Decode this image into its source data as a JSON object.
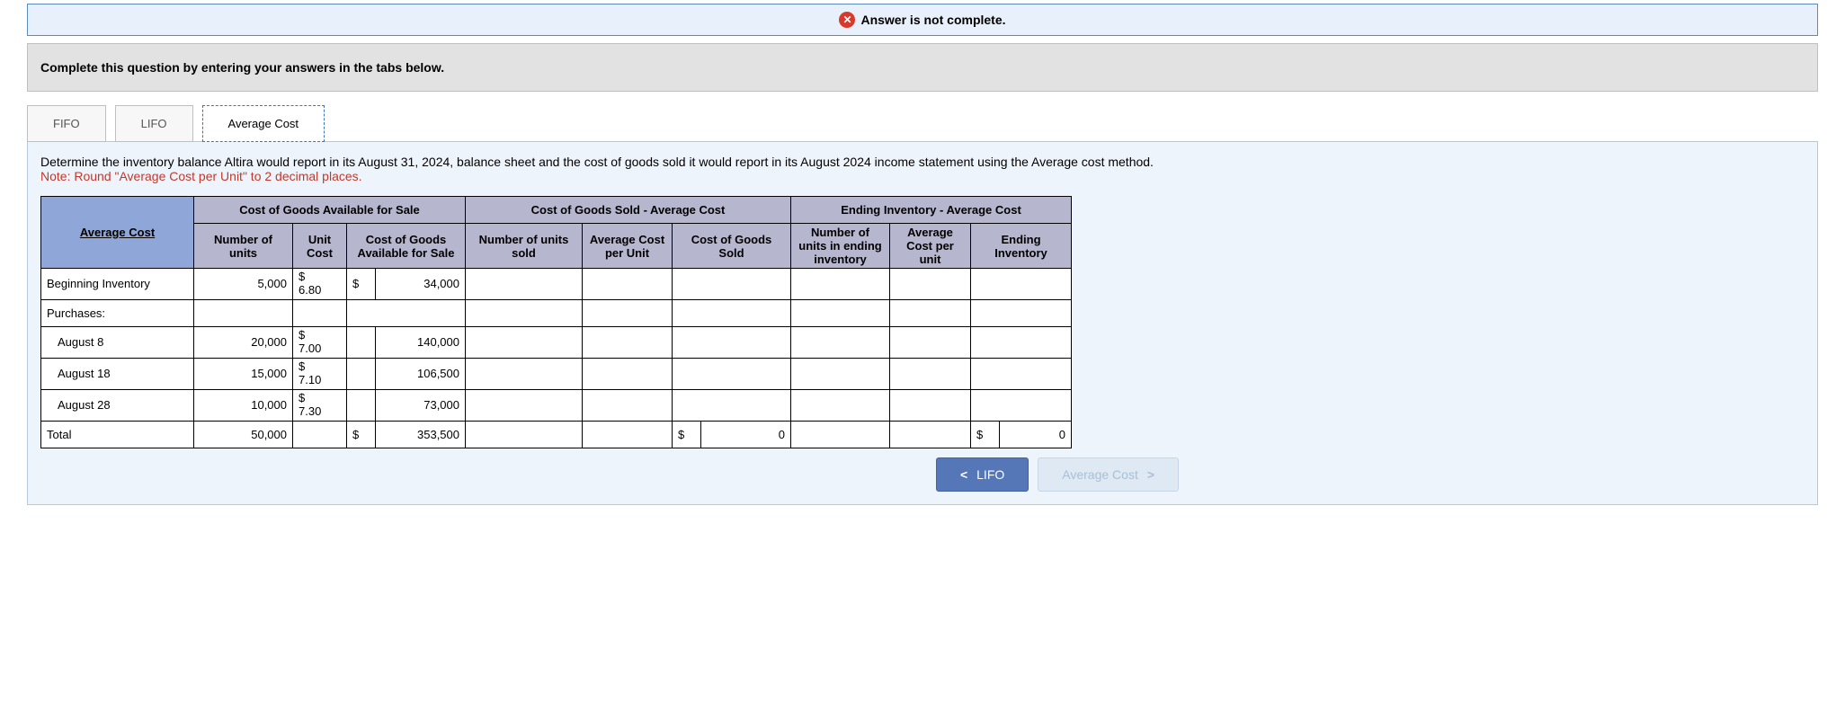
{
  "status": {
    "icon": "x-icon",
    "text": "Answer is not complete."
  },
  "instruction": "Complete this question by entering your answers in the tabs below.",
  "tabs": [
    {
      "label": "FIFO",
      "active": false
    },
    {
      "label": "LIFO",
      "active": false
    },
    {
      "label": "Average Cost",
      "active": true
    }
  ],
  "question": {
    "text": "Determine the inventory balance Altira would report in its August 31, 2024, balance sheet and the cost of goods sold it would report in its August 2024 income statement using the Average cost method.",
    "note": "Note: Round \"Average Cost per Unit\" to 2 decimal places."
  },
  "table": {
    "rowhead": "Average Cost",
    "group1": "Cost of Goods Available for Sale",
    "group2": "Cost of Goods Sold - Average Cost",
    "group3": "Ending Inventory - Average Cost",
    "sub": {
      "units": "Number of units",
      "unitcost": "Unit Cost",
      "cogas": "Cost of Goods Available for Sale",
      "unitsold": "Number of units sold",
      "avgcpu": "Average Cost per Unit",
      "cogs": "Cost of Goods Sold",
      "unitsend": "Number of units in ending inventory",
      "avgcpu2": "Average Cost per unit",
      "endinv": "Ending Inventory"
    },
    "rows": {
      "r1": {
        "label": "Beginning Inventory",
        "units": "5,000",
        "unitcost_sym": "$",
        "unitcost": "6.80",
        "cogas_sym": "$",
        "cogas": "34,000"
      },
      "r2": {
        "label": "Purchases:"
      },
      "r3": {
        "label": "August 8",
        "units": "20,000",
        "unitcost_sym": "$",
        "unitcost": "7.00",
        "cogas": "140,000"
      },
      "r4": {
        "label": "August 18",
        "units": "15,000",
        "unitcost_sym": "$",
        "unitcost": "7.10",
        "cogas": "106,500"
      },
      "r5": {
        "label": "August 28",
        "units": "10,000",
        "unitcost_sym": "$",
        "unitcost": "7.30",
        "cogas": "73,000"
      },
      "r6": {
        "label": "Total",
        "units": "50,000",
        "cogas_sym": "$",
        "cogas": "353,500",
        "cogs_sym": "$",
        "cogs": "0",
        "endinv_sym": "$",
        "endinv": "0"
      }
    }
  },
  "nav": {
    "prev": "LIFO",
    "next": "Average Cost"
  }
}
